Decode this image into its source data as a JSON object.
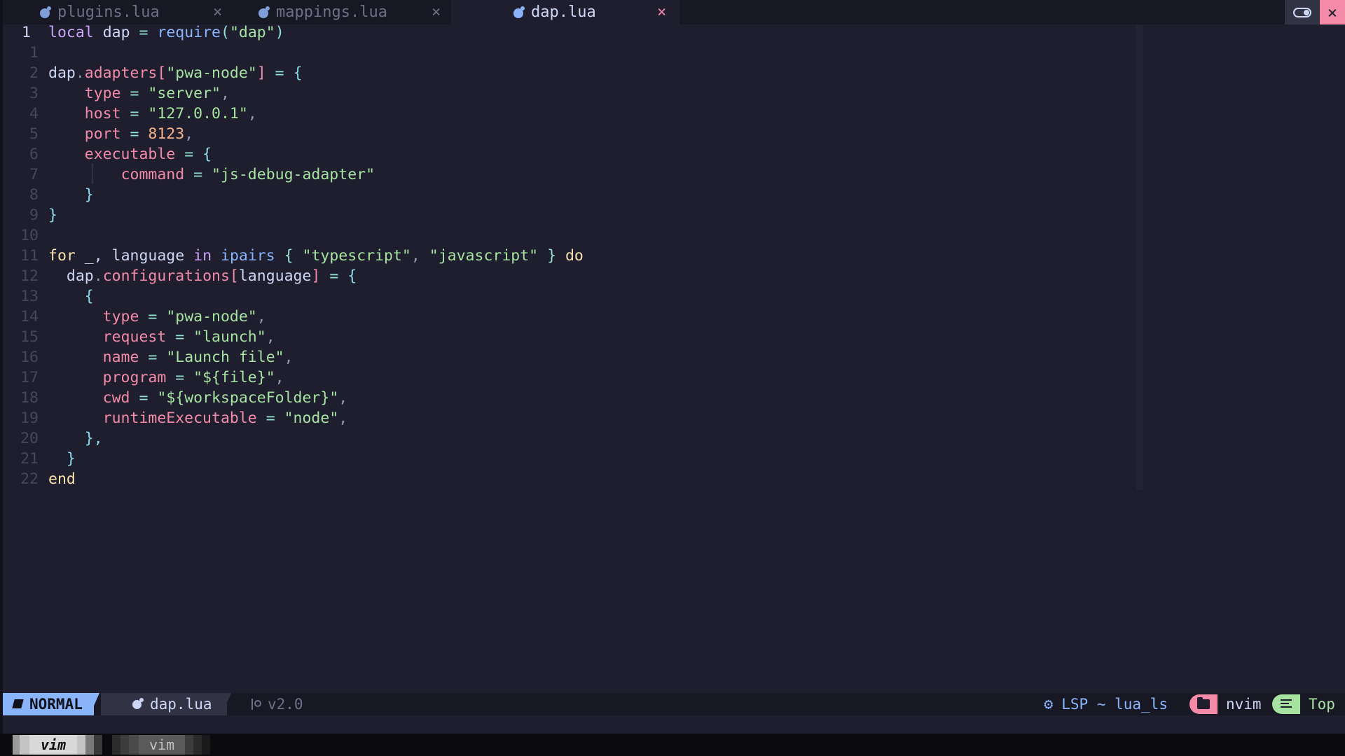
{
  "tabs": [
    {
      "label": "plugins.lua",
      "close": "×",
      "active": false
    },
    {
      "label": "mappings.lua",
      "close": "×",
      "active": false
    },
    {
      "label": "dap.lua",
      "close": "×",
      "active": true
    }
  ],
  "window": {
    "close": "×"
  },
  "lines": [
    {
      "num": "1",
      "current": true
    },
    {
      "num": "1"
    },
    {
      "num": "2"
    },
    {
      "num": "3"
    },
    {
      "num": "4"
    },
    {
      "num": "5"
    },
    {
      "num": "6"
    },
    {
      "num": "7"
    },
    {
      "num": "8"
    },
    {
      "num": "9"
    },
    {
      "num": "10"
    },
    {
      "num": "11"
    },
    {
      "num": "12"
    },
    {
      "num": "13"
    },
    {
      "num": "14"
    },
    {
      "num": "15"
    },
    {
      "num": "16"
    },
    {
      "num": "17"
    },
    {
      "num": "18"
    },
    {
      "num": "19"
    },
    {
      "num": "20"
    },
    {
      "num": "21"
    },
    {
      "num": "22"
    }
  ],
  "code": {
    "l0": [
      "local",
      "dap",
      "=",
      "require",
      "(",
      "\"dap\"",
      ")"
    ],
    "l2": [
      "dap",
      ".",
      "adapters",
      "[",
      "\"pwa-node\"",
      "]",
      "=",
      "{"
    ],
    "l3": [
      "type",
      "=",
      "\"server\"",
      ","
    ],
    "l4": [
      "host",
      "=",
      "\"127.0.0.1\"",
      ","
    ],
    "l5": [
      "port",
      "=",
      "8123",
      ","
    ],
    "l6": [
      "executable",
      "=",
      "{"
    ],
    "l7": [
      "command",
      "=",
      "\"js-debug-adapter\""
    ],
    "l8": [
      "}"
    ],
    "l9": [
      "}"
    ],
    "l11": [
      "for",
      "_,",
      "language",
      "in",
      "ipairs",
      "{",
      "\"typescript\"",
      ",",
      "\"javascript\"",
      "}",
      "do"
    ],
    "l12": [
      "dap",
      ".",
      "configurations",
      "[",
      "language",
      "]",
      "=",
      "{"
    ],
    "l13": [
      "{"
    ],
    "l14": [
      "type",
      "=",
      "\"pwa-node\"",
      ","
    ],
    "l15": [
      "request",
      "=",
      "\"launch\"",
      ","
    ],
    "l16": [
      "name",
      "=",
      "\"Launch file\"",
      ","
    ],
    "l17": [
      "program",
      "=",
      "\"${file}\"",
      ","
    ],
    "l18": [
      "cwd",
      "=",
      "\"${workspaceFolder}\"",
      ","
    ],
    "l19": [
      "runtimeExecutable",
      "=",
      "\"node\"",
      ","
    ],
    "l20": [
      "},"
    ],
    "l21": [
      "}"
    ],
    "l22": [
      "end"
    ]
  },
  "statusline": {
    "mode": "NORMAL",
    "file": "dap.lua",
    "branch": "v2.0",
    "lsp": "LSP ~ lua_ls",
    "project": "nvim",
    "position": "Top"
  },
  "tmux": {
    "windows": [
      {
        "label": "vim",
        "active": true
      },
      {
        "label": "vim",
        "active": false
      }
    ]
  },
  "colors": {
    "background": "#1e1e2e",
    "keyword": "#cba6f7",
    "function": "#89b4fa",
    "string": "#a6e3a1",
    "number": "#fab387",
    "field": "#f38ba8",
    "mode_bg": "#89b4fa"
  }
}
